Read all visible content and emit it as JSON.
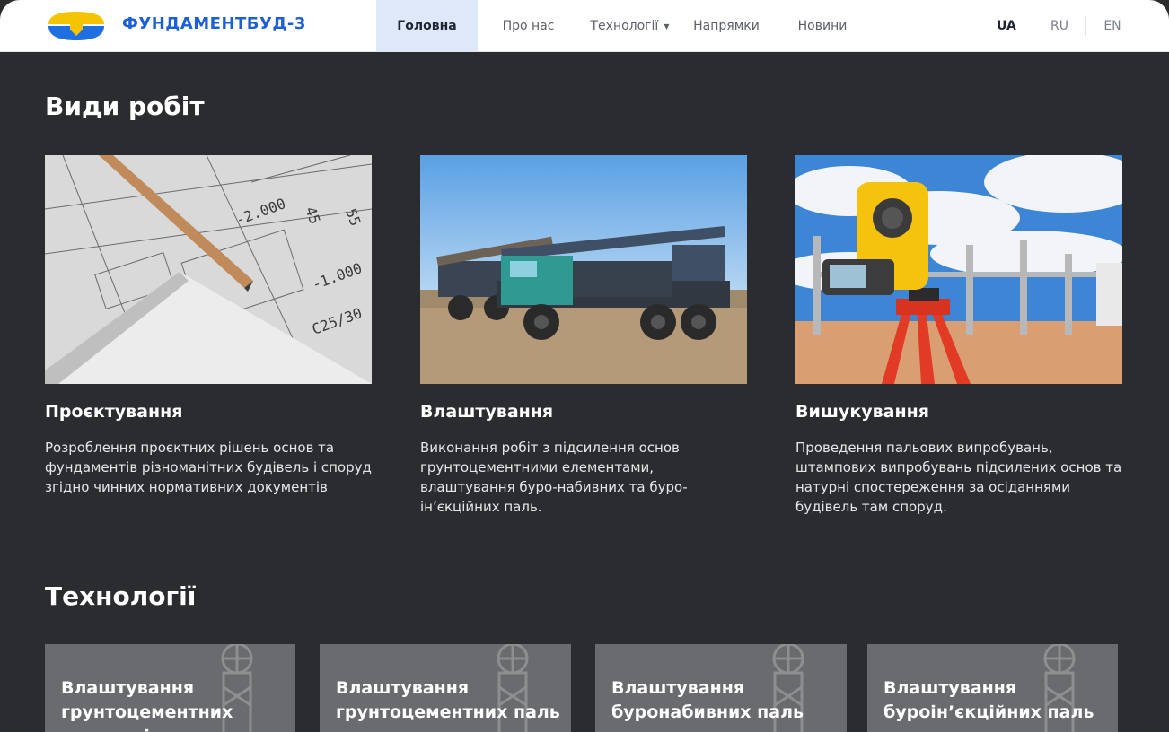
{
  "header": {
    "brand": "ФУНДАМЕНТБУД-3",
    "nav": [
      {
        "label": "Головна",
        "active": true
      },
      {
        "label": "Про нас",
        "active": false
      },
      {
        "label": "Технології",
        "active": false,
        "dropdown": true
      },
      {
        "label": "Напрямки",
        "active": false
      },
      {
        "label": "Новини",
        "active": false
      }
    ],
    "languages": [
      {
        "label": "UA",
        "active": true
      },
      {
        "label": "RU",
        "active": false
      },
      {
        "label": "EN",
        "active": false
      }
    ]
  },
  "works": {
    "title": "Види робіт",
    "items": [
      {
        "title": "Проєктування",
        "text": "Розроблення проєктних рішень основ та фундаментів різноманітних будівель і споруд згідно чинних нормативних документів"
      },
      {
        "title": "Влаштування",
        "text": "Виконання робіт з підсилення основ грунтоцементними елементами, влаштування буро-набивних та буро-ін’єкційних паль."
      },
      {
        "title": "Вишукування",
        "text": "Проведення пальових випробувань, штампових випробувань підсилених основ та натурні спостереження за осіданнями будівель там споруд."
      }
    ]
  },
  "technologies": {
    "title": "Технології",
    "items": [
      {
        "label": "Влаштування грунтоцементних елементів"
      },
      {
        "label": "Влаштування грунтоцементних паль подовжених"
      },
      {
        "label": "Влаштування буронабивних паль"
      },
      {
        "label": "Влаштування буроін’єкційних паль"
      }
    ]
  },
  "colors": {
    "accent": "#1d5fd6",
    "logo_yellow": "#f5c400",
    "logo_blue": "#1f6fe0",
    "background": "#2b2c2f",
    "nav_active_bg": "#dfe8f8"
  }
}
